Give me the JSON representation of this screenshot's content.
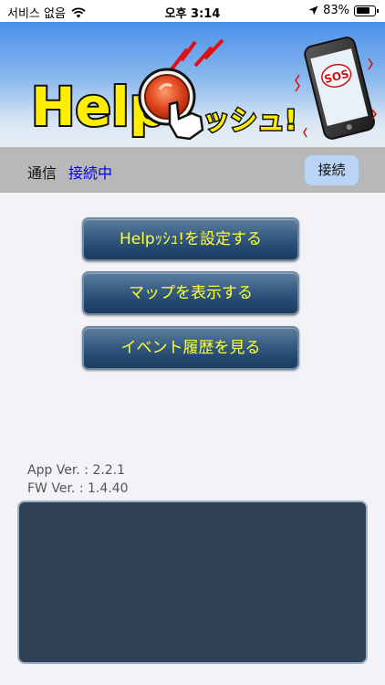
{
  "status_bar": {
    "carrier": "서비스 없음",
    "time": "오후 3:14",
    "battery_percent": "83%",
    "battery_level": 0.83
  },
  "banner": {
    "logo_text_main": "Help",
    "logo_text_suffix": "ッシュ!",
    "phone_badge": "SOS"
  },
  "connection": {
    "label": "通信",
    "status": "接続中",
    "connect_button": "接続"
  },
  "menu": {
    "settings": "Helpｯｼｭ!を設定する",
    "map": "マップを表示する",
    "events": "イベント履歴を見る"
  },
  "versions": {
    "app": "App Ver. : 2.2.1",
    "fw": "FW Ver. : 1.4.40"
  },
  "colors": {
    "status_blue": "#0000e6",
    "button_text": "#ffff33",
    "panel_bg": "#2f4156"
  }
}
